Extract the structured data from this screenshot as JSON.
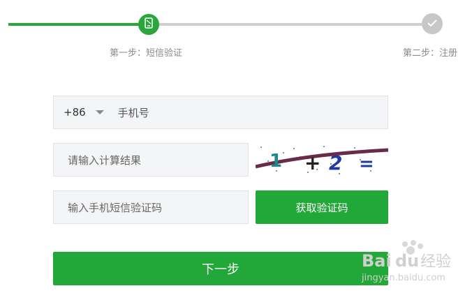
{
  "steps": [
    {
      "label": "第一步：短信验证",
      "status": "current"
    },
    {
      "label": "第二步：注册",
      "status": "upcoming"
    }
  ],
  "progress_fraction": 0.33,
  "colors": {
    "accent": "#22a838",
    "track": "#cfcfcf",
    "field_bg": "#f4f5f7"
  },
  "form": {
    "country_code": "+86",
    "phone_placeholder": "手机号",
    "calc_placeholder": "请输入计算结果",
    "captcha_text": "1+2 =",
    "sms_placeholder": "输入手机短信验证码",
    "get_code_label": "获取验证码",
    "next_label": "下一步"
  },
  "watermark": {
    "brand": "Baidu经验",
    "url": "jingyan.baidu.com"
  }
}
